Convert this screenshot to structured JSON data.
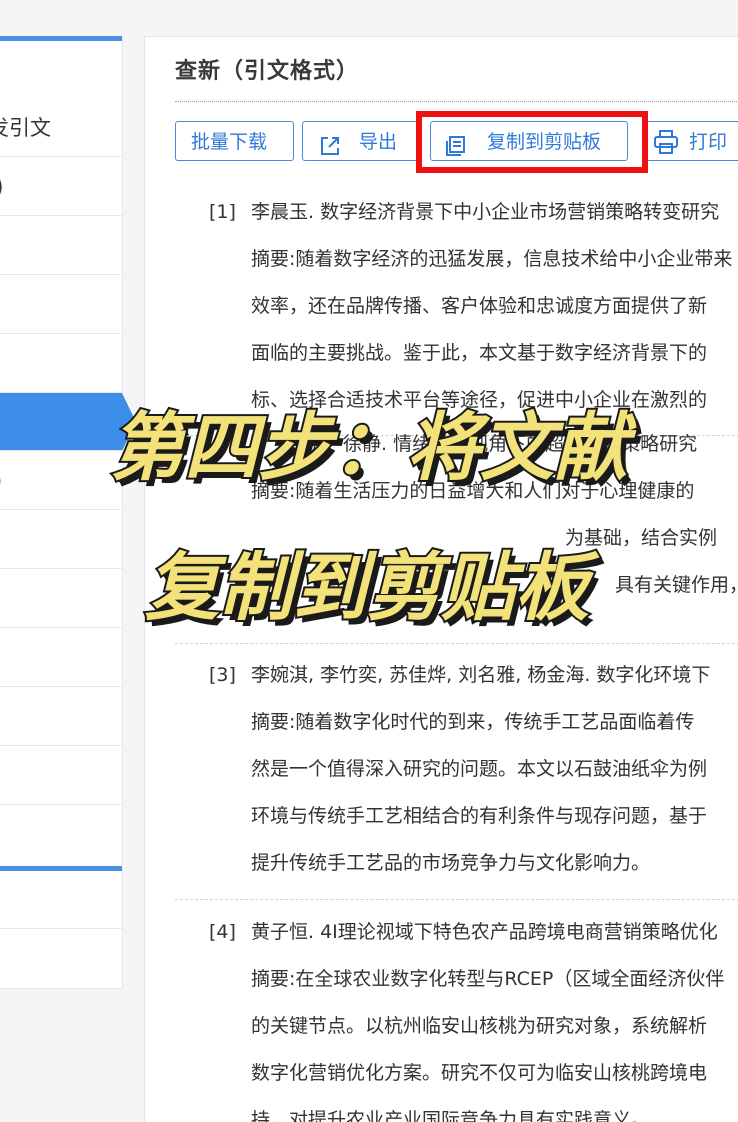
{
  "sidebar": {
    "items": [
      {
        "label": "发引文"
      },
      {
        "label": ")"
      },
      {
        "label": ""
      },
      {
        "label": ""
      },
      {
        "label": ""
      },
      {
        "label": ""
      },
      {
        "label": ")"
      },
      {
        "label": ""
      },
      {
        "label": ""
      },
      {
        "label": ""
      },
      {
        "label": ""
      },
      {
        "label": ""
      },
      {
        "label": ""
      }
    ],
    "accent_color": "#3d8ee8"
  },
  "panel": {
    "title": "查新（引文格式）",
    "toolbar": {
      "batch_download": "批量下载",
      "export": "导出",
      "copy_clipboard": "复制到剪贴板",
      "print": "打印"
    },
    "references": [
      {
        "num": "[1]",
        "lines": [
          "李晨玉. 数字经济背景下中小企业市场营销策略转变研究",
          "摘要:随着数字经济的迅猛发展，信息技术给中小企业带来",
          "效率，还在品牌传播、客户体验和忠诚度方面提供了新",
          "面临的主要挑战。鉴于此，本文基于数字经济背景下的",
          "标、选择合适技术平台等途径，促进中小企业在激烈的"
        ]
      },
      {
        "num": "[2]",
        "lines": [
          "明，徐静. 情绪价值视角下的超市营销策略研究",
          "摘要:随着生活压力的日益增大和人们对于心理健康的",
          "为基础，结合实例",
          "具有关键作用，"
        ]
      },
      {
        "num": "[3]",
        "lines": [
          "李婉淇, 李竹奕, 苏佳烨, 刘名雅, 杨金海. 数字化环境下",
          "摘要:随着数字化时代的到来，传统手工艺品面临着传",
          "然是一个值得深入研究的问题。本文以石鼓油纸伞为例",
          "环境与传统手工艺相结合的有利条件与现存问题，基于",
          "提升传统手工艺品的市场竞争力与文化影响力。"
        ]
      },
      {
        "num": "[4]",
        "lines": [
          "黄子恒. 4I理论视域下特色农产品跨境电商营销策略优化",
          "摘要:在全球农业数字化转型与RCEP（区域全面经济伙伴",
          "的关键节点。以杭州临安山核桃为研究对象，系统解析",
          "数字化营销优化方案。研究不仅可为临安山核桃跨境电",
          "持，对提升农业产业国际竞争力具有实践意义。"
        ]
      }
    ]
  },
  "overlay": {
    "line1": "第四步：将文献",
    "line2": "复制到剪贴板",
    "fill_color": "#f3e27a",
    "outline_color": "#1a1a1a"
  },
  "highlight_color": "#ee1111"
}
